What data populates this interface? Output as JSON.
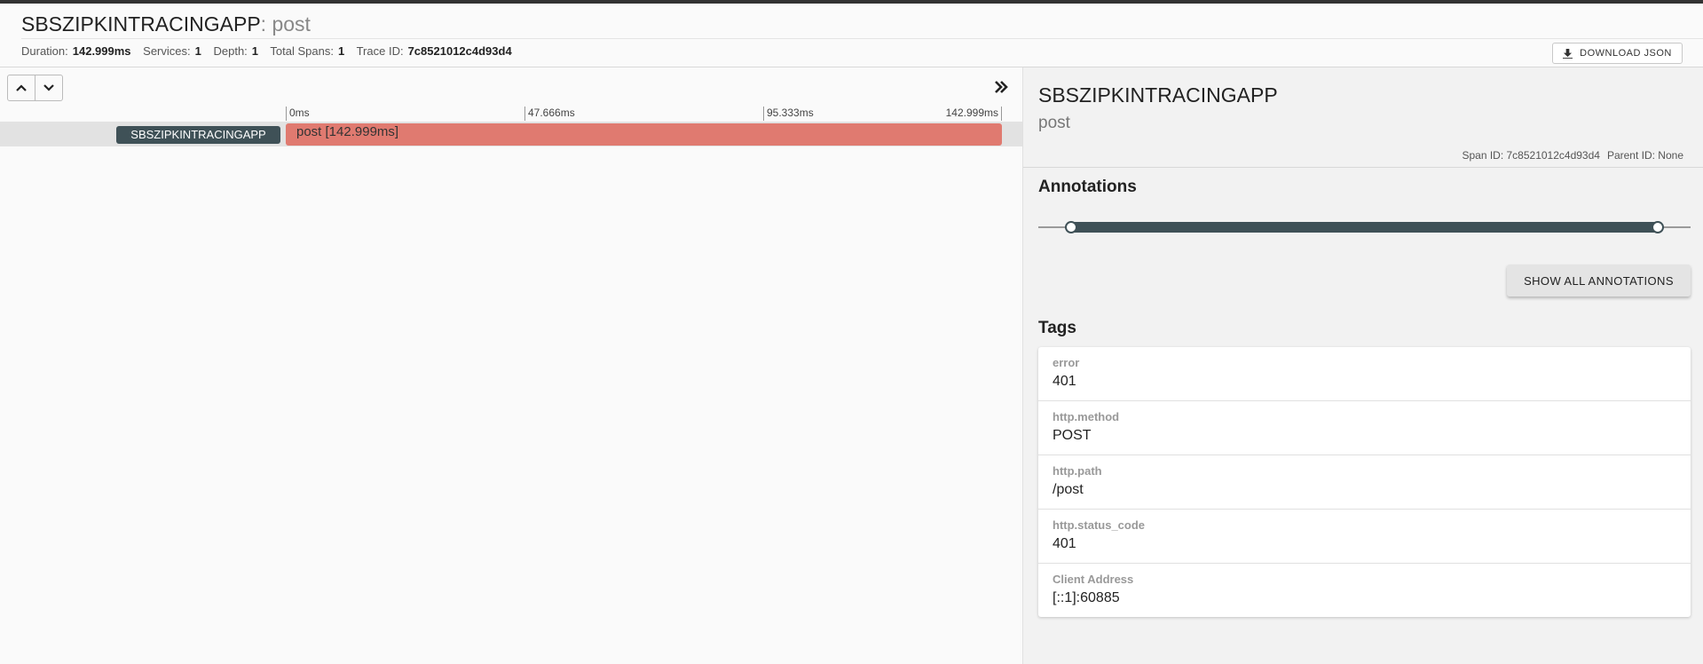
{
  "header": {
    "service_name": "SBSZIPKINTRACINGAPP",
    "separator": ":",
    "operation": "post",
    "meta": [
      {
        "label": "Duration:",
        "value": "142.999ms"
      },
      {
        "label": "Services:",
        "value": "1"
      },
      {
        "label": "Depth:",
        "value": "1"
      },
      {
        "label": "Total Spans:",
        "value": "1"
      },
      {
        "label": "Trace ID:",
        "value": "7c8521012c4d93d4"
      }
    ],
    "download_label": "DOWNLOAD JSON"
  },
  "timeline": {
    "ticks": [
      "0ms",
      "47.666ms",
      "95.333ms",
      "142.999ms"
    ],
    "span": {
      "service": "SBSZIPKINTRACINGAPP",
      "label": "post [142.999ms]",
      "bar_color": "#e07a70"
    }
  },
  "detail": {
    "service_name": "SBSZIPKINTRACINGAPP",
    "operation": "post",
    "span_id": "Span ID: 7c8521012c4d93d4",
    "parent_id": "Parent ID: None",
    "annotations_heading": "Annotations",
    "show_all_label": "SHOW ALL ANNOTATIONS",
    "tags_heading": "Tags",
    "tags": [
      {
        "key": "error",
        "value": "401"
      },
      {
        "key": "http.method",
        "value": "POST"
      },
      {
        "key": "http.path",
        "value": "/post"
      },
      {
        "key": "http.status_code",
        "value": "401"
      },
      {
        "key": "Client Address",
        "value": "[::1]:60885"
      }
    ]
  },
  "icons": {
    "download": "download-icon",
    "up": "chevron-up-icon",
    "down": "chevron-down-icon",
    "expand": "double-chevron-right-icon"
  },
  "colors": {
    "accent": "#3f5157",
    "span_bar": "#e07a70"
  }
}
